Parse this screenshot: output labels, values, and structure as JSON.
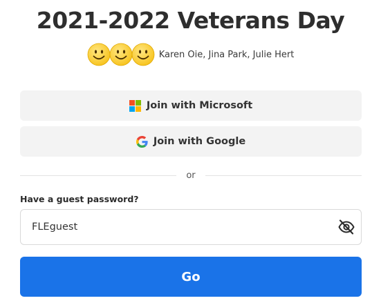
{
  "title": "2021-2022 Veterans Day",
  "owners": {
    "avatars": [
      "smiley-face-icon",
      "smiley-face-icon",
      "smiley-face-icon"
    ],
    "names": "Karen Oie, Jina Park, Julie Hert"
  },
  "sso": {
    "microsoft_label": "Join with Microsoft",
    "microsoft_icon": "microsoft-logo-icon",
    "google_label": "Join with Google",
    "google_icon": "google-logo-icon"
  },
  "divider_text": "or",
  "guest_password": {
    "label": "Have a guest password?",
    "value": "FLEguest",
    "toggle_icon": "eye-slash-icon"
  },
  "submit_label": "Go",
  "colors": {
    "primary": "#1a73e8",
    "button_bg": "#f3f3f3",
    "emoji_yellow": "#ffd23a",
    "ms_red": "#f25022",
    "ms_green": "#7fba00",
    "ms_blue": "#00a4ef",
    "ms_yellow": "#ffb900"
  }
}
